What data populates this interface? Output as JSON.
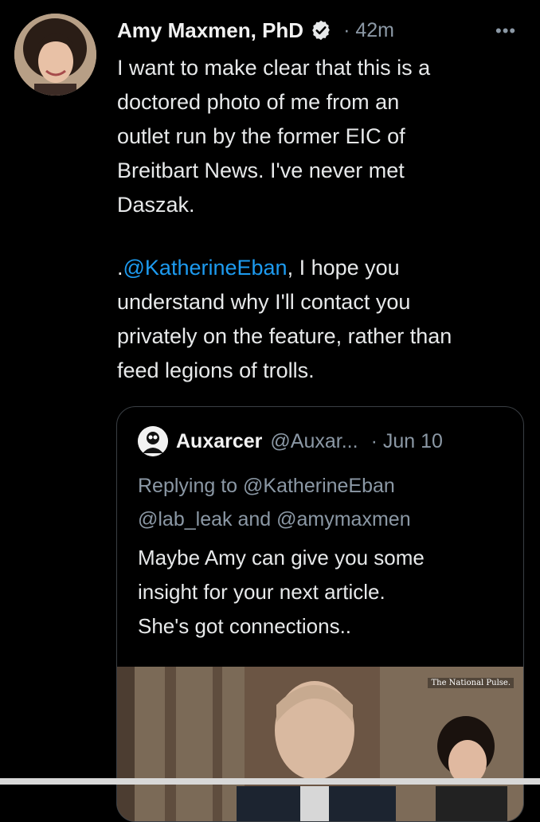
{
  "author": {
    "name": "Amy Maxmen, PhD",
    "verified_icon": "verified-badge-icon",
    "time": "· 42m",
    "more_icon": "more-icon",
    "more_label": "•••"
  },
  "tweet": {
    "para1": "I want to make clear that this is a\ndoctored photo of me from an\noutlet run by the former EIC of\nBreitbart News. I've never met\nDaszak.",
    "para2_prefix": ".",
    "para2_mention": "@KatherineEban",
    "para2_rest": ", I hope you\nunderstand why I'll contact you\nprivately on the feature, rather than\nfeed legions of trolls."
  },
  "quote": {
    "name": "Auxarcer",
    "handle": "@Auxar...",
    "date": "· Jun 10",
    "reply_prefix": "Replying to ",
    "reply_m1": "@KatherineEban",
    "reply_m2": "@lab_leak",
    "reply_and": " and ",
    "reply_m3": "@amymaxmen",
    "text": "Maybe Amy can give you some\ninsight for your next article.\nShe's got connections..",
    "media_watermark": "The National Pulse."
  }
}
